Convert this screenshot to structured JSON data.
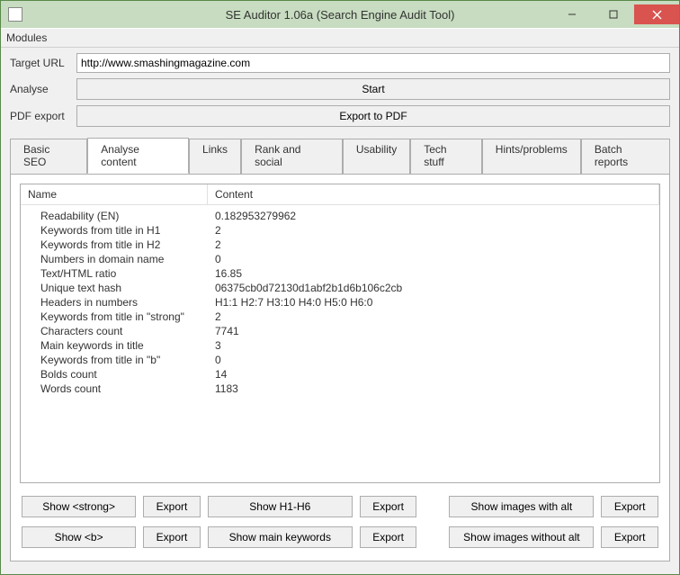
{
  "window": {
    "title": "SE Auditor 1.06a (Search Engine Audit Tool)"
  },
  "menu": {
    "modules": "Modules"
  },
  "form": {
    "target_url_label": "Target URL",
    "target_url_value": "http://www.smashingmagazine.com",
    "analyse_label": "Analyse",
    "start_button": "Start",
    "pdf_export_label": "PDF export",
    "export_pdf_button": "Export to PDF"
  },
  "tabs": [
    "Basic SEO",
    "Analyse content",
    "Links",
    "Rank and social",
    "Usability",
    "Tech stuff",
    "Hints/problems",
    "Batch reports"
  ],
  "table": {
    "headers": [
      "Name",
      "Content"
    ],
    "rows": [
      {
        "name": "Readability (EN)",
        "content": "0.182953279962"
      },
      {
        "name": "Keywords from title in H1",
        "content": "2"
      },
      {
        "name": "Keywords from title in H2",
        "content": "2"
      },
      {
        "name": "Numbers in domain name",
        "content": "0"
      },
      {
        "name": "Text/HTML ratio",
        "content": "16.85"
      },
      {
        "name": "Unique text hash",
        "content": "06375cb0d72130d1abf2b1d6b106c2cb"
      },
      {
        "name": "Headers in numbers",
        "content": "H1:1 H2:7 H3:10 H4:0 H5:0 H6:0"
      },
      {
        "name": "Keywords from title in \"strong\"",
        "content": "2"
      },
      {
        "name": "Characters count",
        "content": "7741"
      },
      {
        "name": "Main keywords in title",
        "content": "3"
      },
      {
        "name": "Keywords from title in \"b\"",
        "content": "0"
      },
      {
        "name": "Bolds count",
        "content": "14"
      },
      {
        "name": "Words count",
        "content": "1183"
      }
    ]
  },
  "buttons": {
    "export": "Export",
    "row1": {
      "show_strong": "Show <strong>",
      "show_h1h6": "Show H1-H6",
      "show_images_with_alt": "Show images with alt"
    },
    "row2": {
      "show_b": "Show <b>",
      "show_main_keywords": "Show main keywords",
      "show_images_without_alt": "Show images without alt"
    }
  }
}
